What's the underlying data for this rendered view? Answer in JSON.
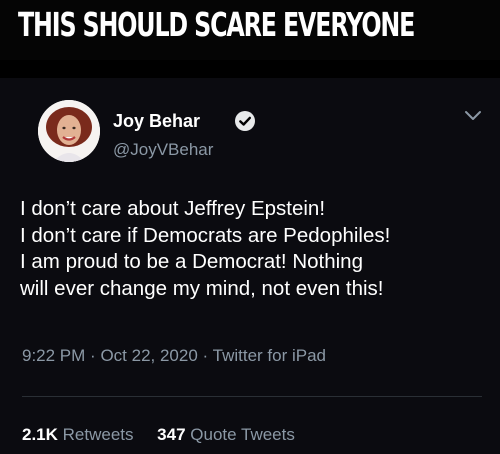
{
  "banner": {
    "text": "THIS SHOULD SCARE EVERYONE"
  },
  "tweet": {
    "author": {
      "name": "Joy Behar",
      "handle": "@JoyVBehar",
      "verified_icon": "verified-badge-icon",
      "avatar": "profile-photo"
    },
    "menu_icon": "chevron-down-icon",
    "lines": [
      "I don’t care about Jeffrey Epstein!",
      "I don’t care if Democrats are Pedophiles!",
      "I am proud to be a Democrat! Nothing",
      "will ever change my mind, not even this!"
    ],
    "time": "9:22 PM",
    "date": "Oct 22, 2020",
    "source": "Twitter for iPad",
    "separator": "·",
    "stats": {
      "retweets_count": "2.1K",
      "retweets_label": "Retweets",
      "quotes_count": "347",
      "quotes_label": "Quote Tweets"
    }
  },
  "colors": {
    "background": "#000000",
    "text": "#ffffff",
    "muted": "#8b98a5",
    "verified": "#e7e9ea"
  }
}
